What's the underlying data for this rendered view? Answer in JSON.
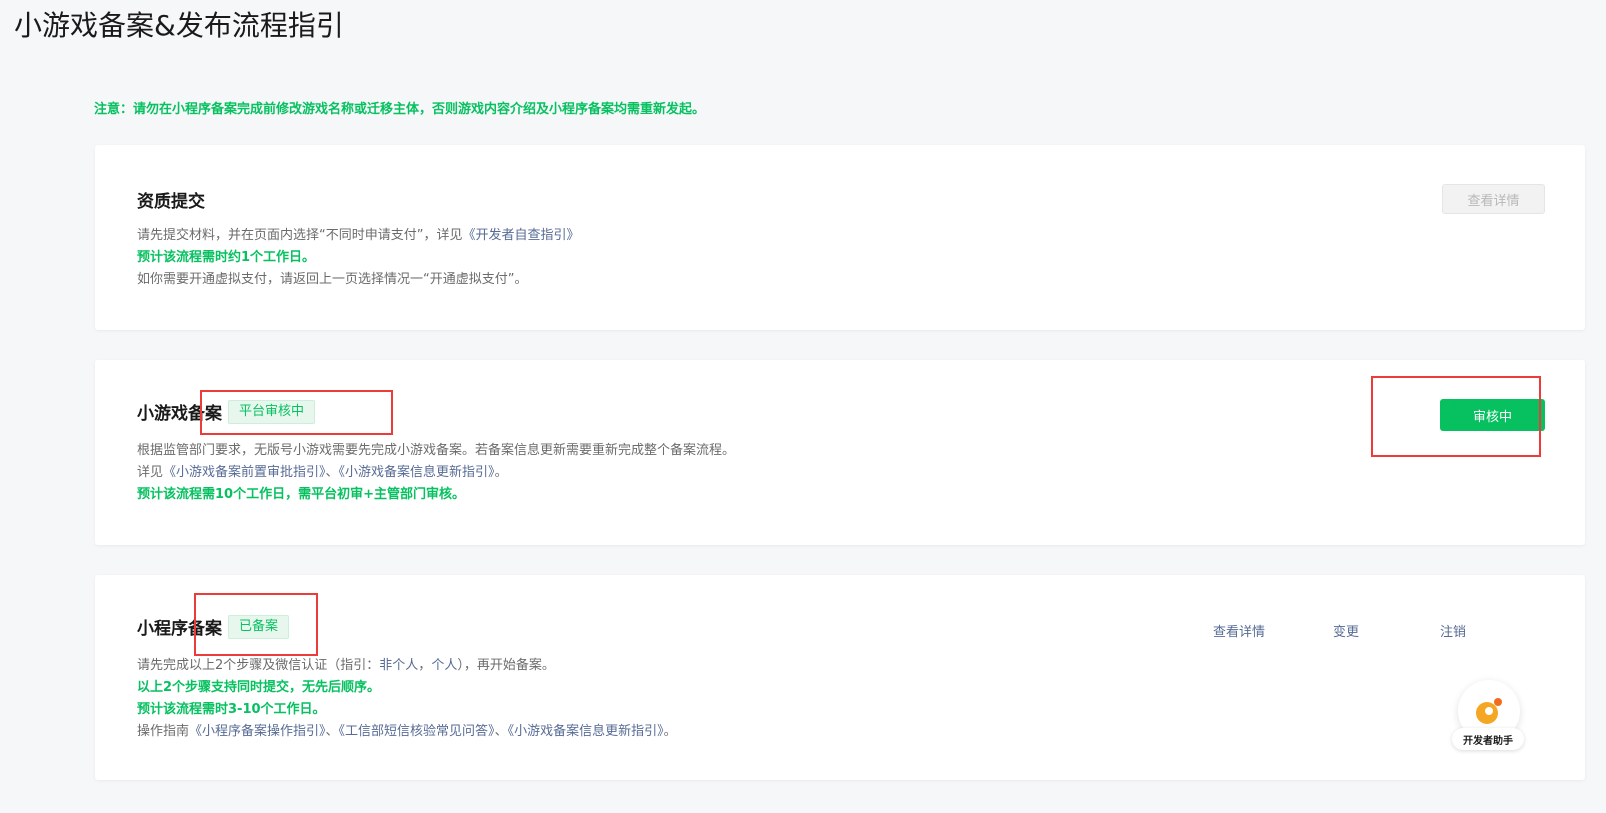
{
  "page": {
    "title": "小游戏备案&发布流程指引",
    "notice": "注意：请勿在小程序备案完成前修改游戏名称或迁移主体，否则游戏内容介绍及小程序备案均需重新发起。"
  },
  "cards": {
    "qualification": {
      "title": "资质提交",
      "button_label": "查看详情",
      "line1_text": "请先提交材料，并在页面内选择“不同时申请支付”，详见",
      "line1_link": "《开发者自查指引》",
      "line2": "预计该流程需时约1个工作日。",
      "line3": "如你需要开通虚拟支付，请返回上一页选择情况一“开通虚拟支付”。"
    },
    "game_filing": {
      "title": "小游戏备案",
      "status": "平台审核中",
      "button_label": "审核中",
      "line1": "根据监管部门要求，无版号小游戏需要先完成小游戏备案。若备案信息更新需要重新完成整个备案流程。",
      "line2_prefix": "详见",
      "line2_link1": "《小游戏备案前置审批指引》",
      "line2_sep": "、",
      "line2_link2": "《小游戏备案信息更新指引》",
      "line2_suffix": "。",
      "line3": "预计该流程需10个工作日，需平台初审+主管部门审核。"
    },
    "miniprogram_filing": {
      "title": "小程序备案",
      "status": "已备案",
      "action_view": "查看详情",
      "action_change": "变更",
      "action_cancel": "注销",
      "line1_prefix": "请先完成以上2个步骤及微信认证（指引：",
      "line1_link1": "非个人",
      "line1_sep": "，",
      "line1_link2": "个人",
      "line1_suffix": "），再开始备案。",
      "line2": "以上2个步骤支持同时提交，无先后顺序。",
      "line3": "预计该流程需时3-10个工作日。",
      "line4_prefix": "操作指南",
      "line4_link1": "《小程序备案操作指引》",
      "line4_sep1": "、",
      "line4_link2": "《工信部短信核验常见问答》",
      "line4_sep2": "、",
      "line4_link3": "《小游戏备案信息更新指引》",
      "line4_suffix": "。"
    }
  },
  "helper": {
    "label": "开发者助手",
    "icon": "developer-assistant-icon"
  },
  "colors": {
    "accent": "#07c160",
    "link": "#576b95",
    "highlight": "#ec3b3b"
  }
}
